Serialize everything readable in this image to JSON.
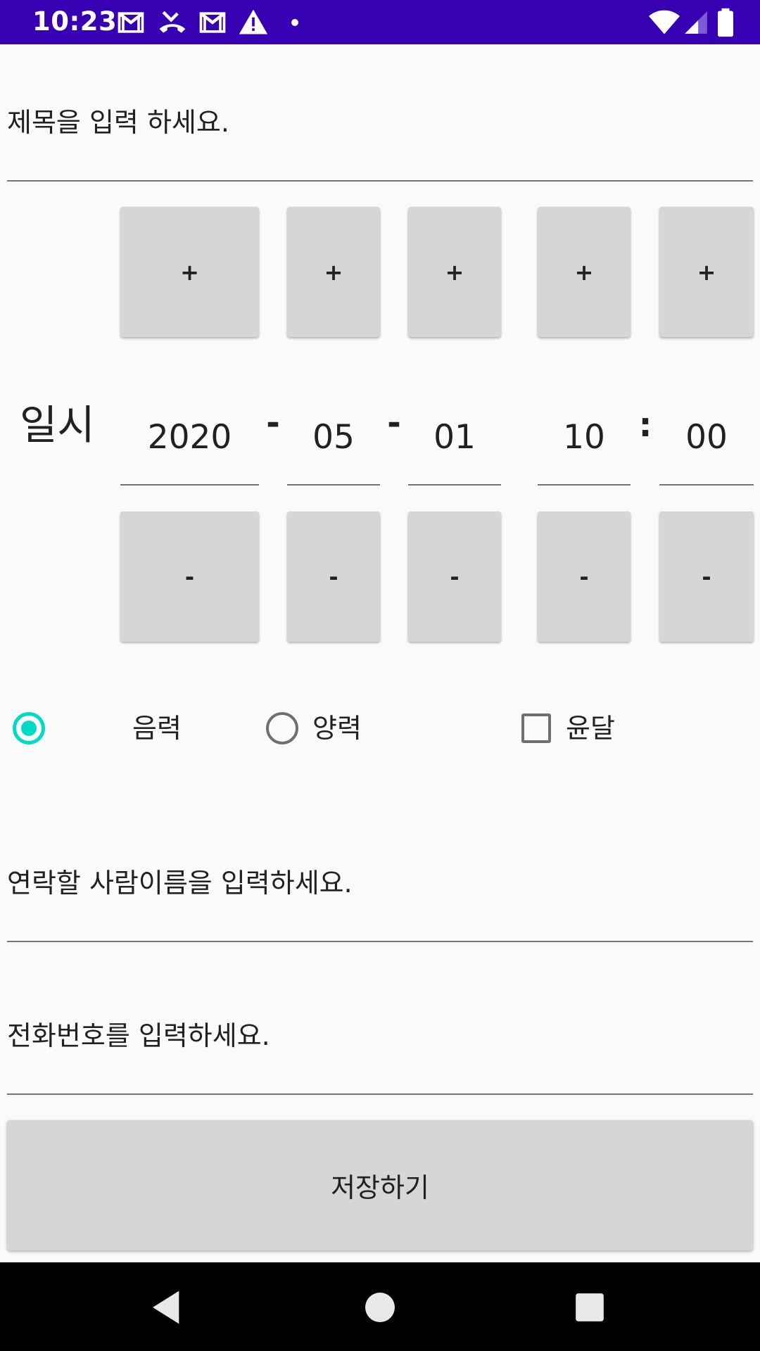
{
  "status_bar": {
    "time": "10:23",
    "notification_icons": [
      "gmail-icon",
      "missed-call-icon",
      "gmail-icon",
      "warning-icon",
      "dot-icon"
    ],
    "system_icons": [
      "wifi-icon",
      "signal-icon",
      "battery-icon"
    ],
    "background": "#3700b3"
  },
  "form": {
    "title_placeholder": "제목을 입력 하세요.",
    "date_label": "일시",
    "plus_label": "+",
    "minus_label": "-",
    "year": "2020",
    "month": "05",
    "day": "01",
    "hour": "10",
    "minute": "00",
    "date_separator": "-",
    "time_separator": ":",
    "calendar_options": {
      "lunar_label": "음력",
      "solar_label": "양력",
      "leap_month_label": "윤달",
      "selected": "lunar",
      "leap_month_checked": false
    },
    "contact_name_placeholder": "연락할 사람이름을 입력하세요.",
    "phone_placeholder": "전화번호를 입력하세요.",
    "save_label": "저장하기"
  },
  "nav_bar": {
    "icons": [
      "back-icon",
      "home-icon",
      "recents-icon"
    ]
  },
  "colors": {
    "accent": "#03dac5",
    "primary_dark": "#3700b3",
    "button_bg": "#d6d6d6"
  }
}
